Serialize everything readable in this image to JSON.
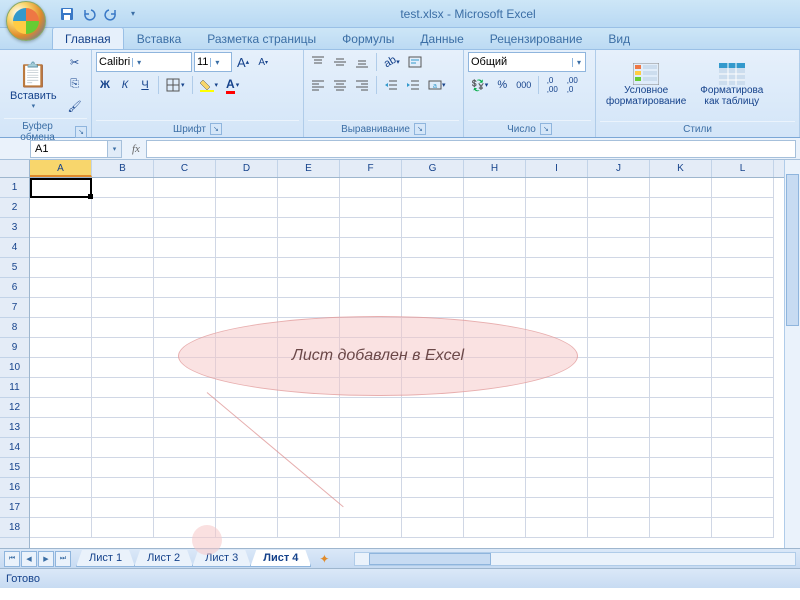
{
  "title": "test.xlsx - Microsoft Excel",
  "tabs": {
    "t0": "Главная",
    "t1": "Вставка",
    "t2": "Разметка страницы",
    "t3": "Формулы",
    "t4": "Данные",
    "t5": "Рецензирование",
    "t6": "Вид"
  },
  "groups": {
    "clipboard": "Буфер обмена",
    "font": "Шрифт",
    "alignment": "Выравнивание",
    "number": "Число",
    "styles": "Стили"
  },
  "clipboard": {
    "paste": "Вставить"
  },
  "font": {
    "name": "Calibri",
    "size": "11",
    "bold": "Ж",
    "italic": "К",
    "underline": "Ч"
  },
  "number": {
    "format": "Общий",
    "percent": "%"
  },
  "styles": {
    "cond": "Условное\nформатирование",
    "table": "Форматирова\nкак таблицу"
  },
  "namebox": "A1",
  "fx_label": "fx",
  "columns": [
    "A",
    "B",
    "C",
    "D",
    "E",
    "F",
    "G",
    "H",
    "I",
    "J",
    "K",
    "L"
  ],
  "rows": [
    "1",
    "2",
    "3",
    "4",
    "5",
    "6",
    "7",
    "8",
    "9",
    "10",
    "11",
    "12",
    "13",
    "14",
    "15",
    "16",
    "17",
    "18"
  ],
  "sheets": {
    "s1": "Лист 1",
    "s2": "Лист 2",
    "s3": "Лист 3",
    "s4": "Лист 4"
  },
  "status": "Готово",
  "annotation": "Лист добавлен в Excel"
}
